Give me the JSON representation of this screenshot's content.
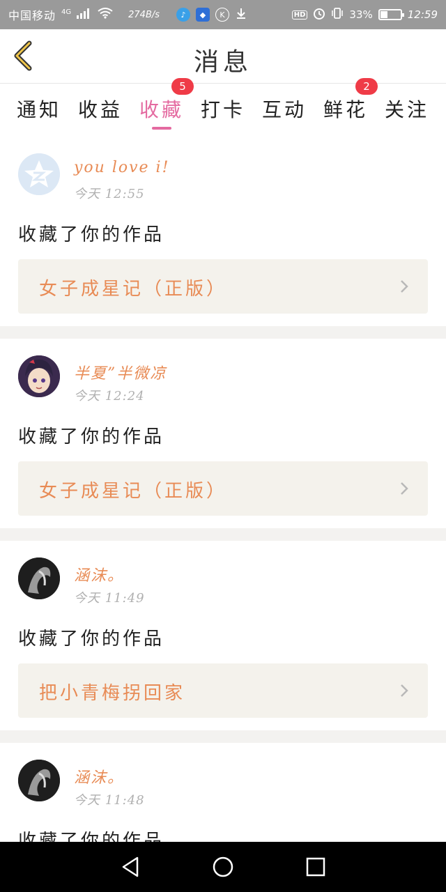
{
  "status_bar": {
    "carrier": "中国移动",
    "network_type": "4G",
    "speed": "274B/s",
    "battery": "33%",
    "time": "12:59",
    "hd_label": "HD"
  },
  "header": {
    "title": "消息"
  },
  "tabs": [
    {
      "label": "通知",
      "badge": ""
    },
    {
      "label": "收益",
      "badge": ""
    },
    {
      "label": "收藏",
      "badge": "5",
      "active": true
    },
    {
      "label": "打卡",
      "badge": ""
    },
    {
      "label": "互动",
      "badge": ""
    },
    {
      "label": "鲜花",
      "badge": "2"
    },
    {
      "label": "关注",
      "badge": ""
    }
  ],
  "feed": [
    {
      "user": "you love i!",
      "time": "今天 12:55",
      "action": "收藏了你的作品",
      "work": "女子成星记（正版）"
    },
    {
      "user": "半夏”半微凉",
      "time": "今天 12:24",
      "action": "收藏了你的作品",
      "work": "女子成星记（正版）"
    },
    {
      "user": "涵沫。",
      "time": "今天 11:49",
      "action": "收藏了你的作品",
      "work": "把小青梅拐回家"
    },
    {
      "user": "涵沫。",
      "time": "今天 11:48",
      "action": "收藏了你的作品",
      "work": ""
    }
  ],
  "colors": {
    "accent": "#e46aa0",
    "orange": "#e88b55",
    "badge": "#ef3b47"
  }
}
